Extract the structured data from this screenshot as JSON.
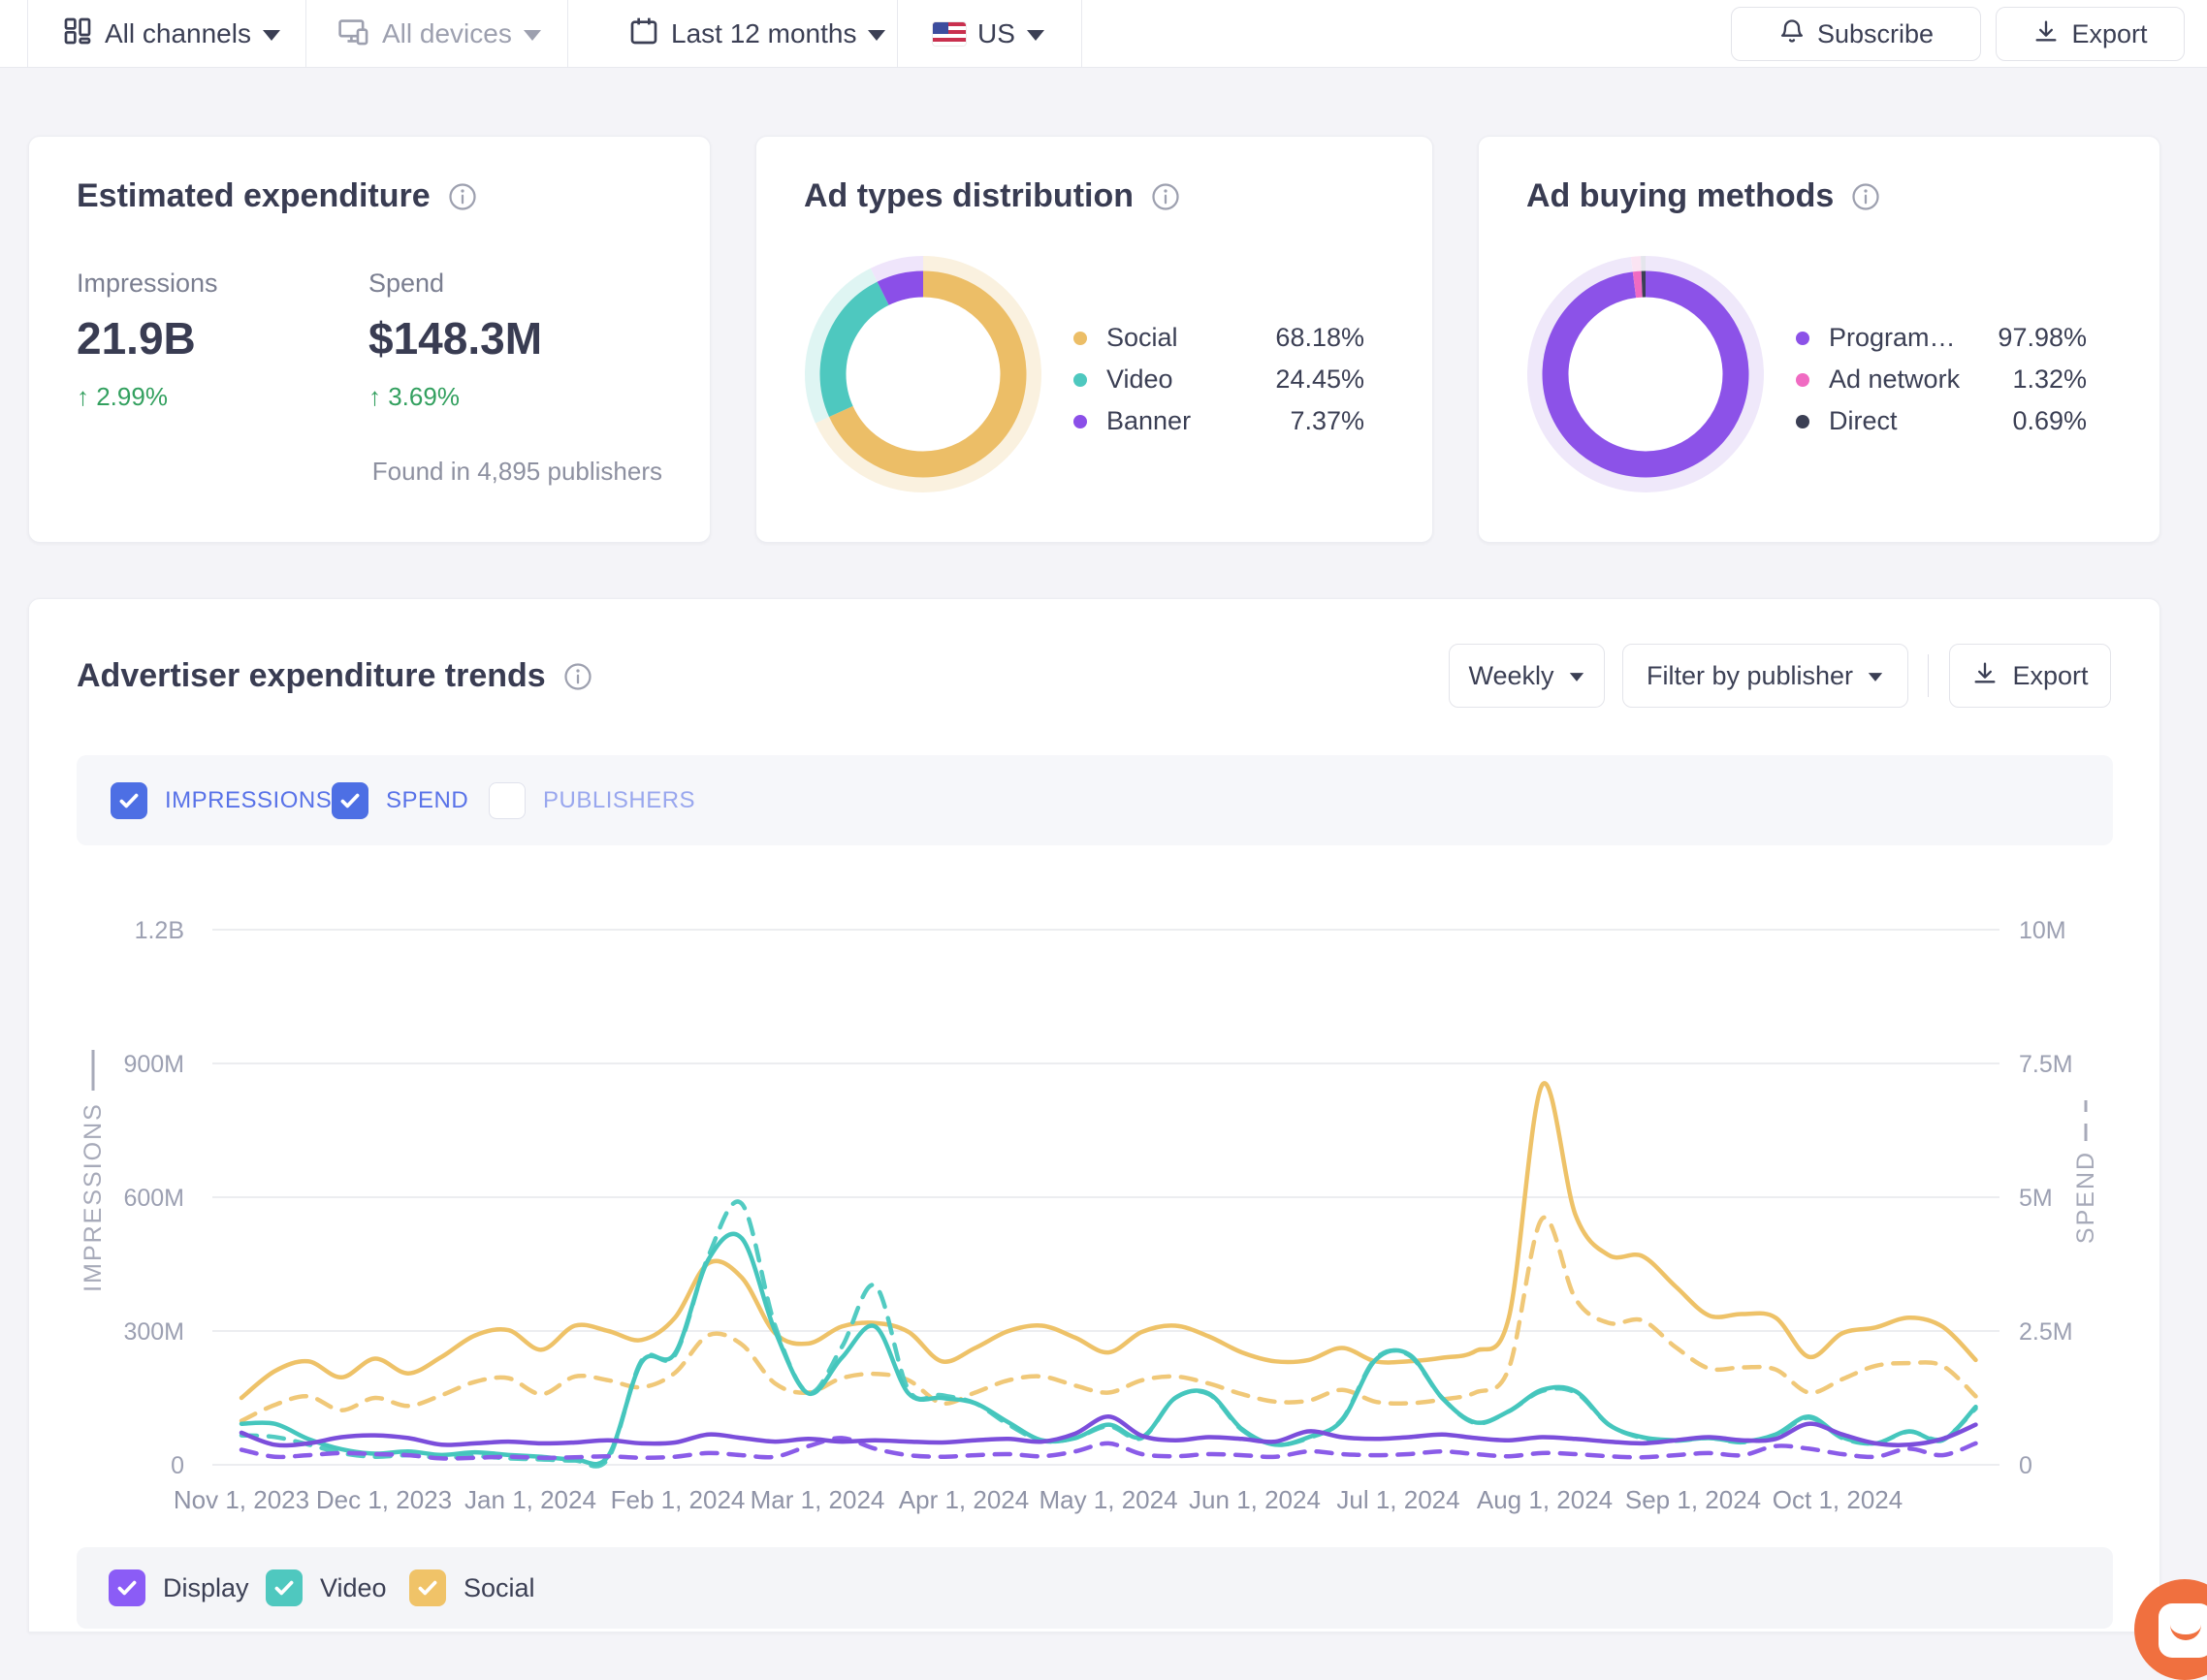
{
  "toolbar": {
    "channels_label": "All channels",
    "devices_label": "All devices",
    "date_range_label": "Last 12 months",
    "country_label": "US",
    "subscribe_label": "Subscribe",
    "export_label": "Export"
  },
  "cards": {
    "expenditure": {
      "title": "Estimated expenditure",
      "impressions_label": "Impressions",
      "impressions_value": "21.9B",
      "impressions_change": "↑ 2.99%",
      "spend_label": "Spend",
      "spend_value": "$148.3M",
      "spend_change": "↑ 3.69%",
      "publishers_note": "Found in 4,895 publishers"
    },
    "ad_types": {
      "title": "Ad types distribution",
      "legend": [
        {
          "label": "Social",
          "value": "68.18%",
          "pct": 68.18,
          "color": "#ECBE67",
          "halo": "#FAF1DF"
        },
        {
          "label": "Video",
          "value": "24.45%",
          "pct": 24.45,
          "color": "#4EC8BF",
          "halo": "#DFF5F3"
        },
        {
          "label": "Banner",
          "value": "7.37%",
          "pct": 7.37,
          "color": "#8B4FE8",
          "halo": "#EFE5FB"
        }
      ]
    },
    "ad_buying": {
      "title": "Ad buying methods",
      "legend": [
        {
          "label": "Program…",
          "value": "97.98%",
          "pct": 97.98,
          "color": "#8C52E8",
          "halo": "#EFE8FA"
        },
        {
          "label": "Ad network",
          "value": "1.32%",
          "pct": 1.32,
          "color": "#F06BC2",
          "halo": "#FBE4F3"
        },
        {
          "label": "Direct",
          "value": "0.69%",
          "pct": 0.69,
          "color": "#3B3F54",
          "halo": "#E4E5EC"
        }
      ]
    }
  },
  "trends": {
    "title": "Advertiser expenditure trends",
    "period_label": "Weekly",
    "filter_label": "Filter by publisher",
    "export_label": "Export",
    "metric_toggles": [
      {
        "label": "IMPRESSIONS",
        "checked": true,
        "box_color": "#4D6FE4",
        "label_color": "#5872E8"
      },
      {
        "label": "SPEND",
        "checked": true,
        "box_color": "#4D6FE4",
        "label_color": "#5872E8"
      },
      {
        "label": "PUBLISHERS",
        "checked": false,
        "box_color": "#FFFFFF",
        "label_color": "#99A7EE"
      }
    ],
    "series_toggles": [
      {
        "label": "Display",
        "checked": true,
        "box_color": "#8B5CF6",
        "label_color": "#3B3F54"
      },
      {
        "label": "Video",
        "checked": true,
        "box_color": "#4FC8BF",
        "label_color": "#3B3F54"
      },
      {
        "label": "Social",
        "checked": true,
        "box_color": "#F0C368",
        "label_color": "#3B3F54"
      }
    ]
  },
  "chart_data": {
    "type": "line",
    "interval": "weekly",
    "x_tick_labels": [
      "Nov 1, 2023",
      "Dec 1, 2023",
      "Jan 1, 2024",
      "Feb 1, 2024",
      "Mar 1, 2024",
      "Apr 1, 2024",
      "May 1, 2024",
      "Jun 1, 2024",
      "Jul 1, 2024",
      "Aug 1, 2024",
      "Sep 1, 2024",
      "Oct 1, 2024"
    ],
    "left_axis": {
      "label": "IMPRESSIONS",
      "unit": "impressions",
      "ticks": [
        {
          "label": "1.2B",
          "v": 1200
        },
        {
          "label": "900M",
          "v": 900
        },
        {
          "label": "600M",
          "v": 600
        },
        {
          "label": "300M",
          "v": 300
        },
        {
          "label": "0",
          "v": 0
        }
      ],
      "max": 1200
    },
    "right_axis": {
      "label": "SPEND",
      "unit": "USD",
      "ticks": [
        {
          "label": "10M",
          "v": 10
        },
        {
          "label": "7.5M",
          "v": 7.5
        },
        {
          "label": "5M",
          "v": 5
        },
        {
          "label": "2.5M",
          "v": 2.5
        },
        {
          "label": "0",
          "v": 0
        }
      ],
      "max": 10
    },
    "series": [
      {
        "name": "Social spend",
        "axis": "right",
        "style": "dashed",
        "color": "#F0C878",
        "unit": "$M",
        "values": [
          0.82,
          1.12,
          1.28,
          1.02,
          1.25,
          1.1,
          1.3,
          1.55,
          1.62,
          1.32,
          1.65,
          1.58,
          1.45,
          1.72,
          2.42,
          2.25,
          1.52,
          1.35,
          1.62,
          1.7,
          1.58,
          1.15,
          1.35,
          1.58,
          1.65,
          1.48,
          1.35,
          1.58,
          1.65,
          1.52,
          1.32,
          1.18,
          1.2,
          1.4,
          1.18,
          1.15,
          1.22,
          1.35,
          1.8,
          4.6,
          3.1,
          2.65,
          2.7,
          2.2,
          1.8,
          1.82,
          1.78,
          1.35,
          1.6,
          1.85,
          1.9,
          1.85,
          1.28
        ]
      },
      {
        "name": "Social impressions",
        "axis": "left",
        "style": "solid",
        "color": "#EEC268",
        "unit": "M",
        "values": [
          150,
          210,
          232,
          196,
          238,
          205,
          242,
          290,
          302,
          258,
          312,
          300,
          280,
          330,
          452,
          420,
          295,
          272,
          310,
          318,
          298,
          232,
          262,
          300,
          312,
          285,
          252,
          298,
          312,
          288,
          252,
          232,
          235,
          262,
          232,
          232,
          240,
          255,
          330,
          852,
          560,
          470,
          468,
          400,
          335,
          338,
          330,
          242,
          295,
          308,
          330,
          310,
          235
        ]
      },
      {
        "name": "Video spend",
        "axis": "right",
        "style": "dashed",
        "color": "#52CBC2",
        "unit": "$M",
        "values": [
          0.55,
          0.52,
          0.38,
          0.22,
          0.15,
          0.18,
          0.13,
          0.16,
          0.12,
          0.1,
          0.08,
          0.12,
          1.95,
          2.05,
          3.9,
          4.88,
          2.6,
          1.35,
          2.2,
          3.35,
          1.4,
          1.3,
          1.15,
          0.75,
          0.45,
          0.5,
          0.72,
          0.5,
          1.25,
          1.32,
          0.65,
          0.38,
          0.5,
          0.85,
          1.98,
          2.05,
          1.25,
          0.78,
          1.0,
          1.38,
          1.35,
          0.75,
          0.5,
          0.45,
          0.5,
          0.42,
          0.55,
          0.88,
          0.5,
          0.4,
          0.62,
          0.48,
          1.05
        ]
      },
      {
        "name": "Video impressions",
        "axis": "left",
        "style": "solid",
        "color": "#45C6BD",
        "unit": "M",
        "values": [
          92,
          92,
          58,
          35,
          25,
          30,
          22,
          28,
          22,
          18,
          12,
          20,
          230,
          250,
          460,
          508,
          300,
          160,
          240,
          310,
          160,
          150,
          138,
          95,
          55,
          60,
          90,
          62,
          150,
          160,
          80,
          45,
          62,
          100,
          235,
          248,
          150,
          95,
          120,
          168,
          165,
          90,
          62,
          55,
          60,
          52,
          68,
          108,
          62,
          48,
          75,
          55,
          130
        ]
      },
      {
        "name": "Display spend",
        "axis": "right",
        "style": "dashed",
        "color": "#8A5CE8",
        "unit": "$M",
        "values": [
          0.28,
          0.15,
          0.18,
          0.22,
          0.2,
          0.18,
          0.12,
          0.13,
          0.15,
          0.13,
          0.14,
          0.16,
          0.13,
          0.15,
          0.22,
          0.18,
          0.15,
          0.35,
          0.5,
          0.3,
          0.18,
          0.15,
          0.18,
          0.2,
          0.16,
          0.25,
          0.4,
          0.2,
          0.16,
          0.2,
          0.18,
          0.15,
          0.25,
          0.2,
          0.18,
          0.2,
          0.25,
          0.2,
          0.16,
          0.22,
          0.2,
          0.16,
          0.14,
          0.18,
          0.22,
          0.18,
          0.35,
          0.3,
          0.2,
          0.15,
          0.3,
          0.18,
          0.4
        ]
      },
      {
        "name": "Display impressions",
        "axis": "left",
        "style": "solid",
        "color": "#7B4EDB",
        "unit": "M",
        "values": [
          72,
          45,
          48,
          62,
          66,
          60,
          45,
          48,
          52,
          48,
          50,
          55,
          48,
          50,
          68,
          60,
          52,
          58,
          52,
          55,
          52,
          50,
          55,
          58,
          52,
          70,
          108,
          65,
          55,
          62,
          58,
          52,
          75,
          62,
          58,
          62,
          68,
          60,
          55,
          62,
          58,
          52,
          48,
          55,
          62,
          55,
          58,
          92,
          68,
          48,
          45,
          58,
          90
        ]
      }
    ]
  }
}
